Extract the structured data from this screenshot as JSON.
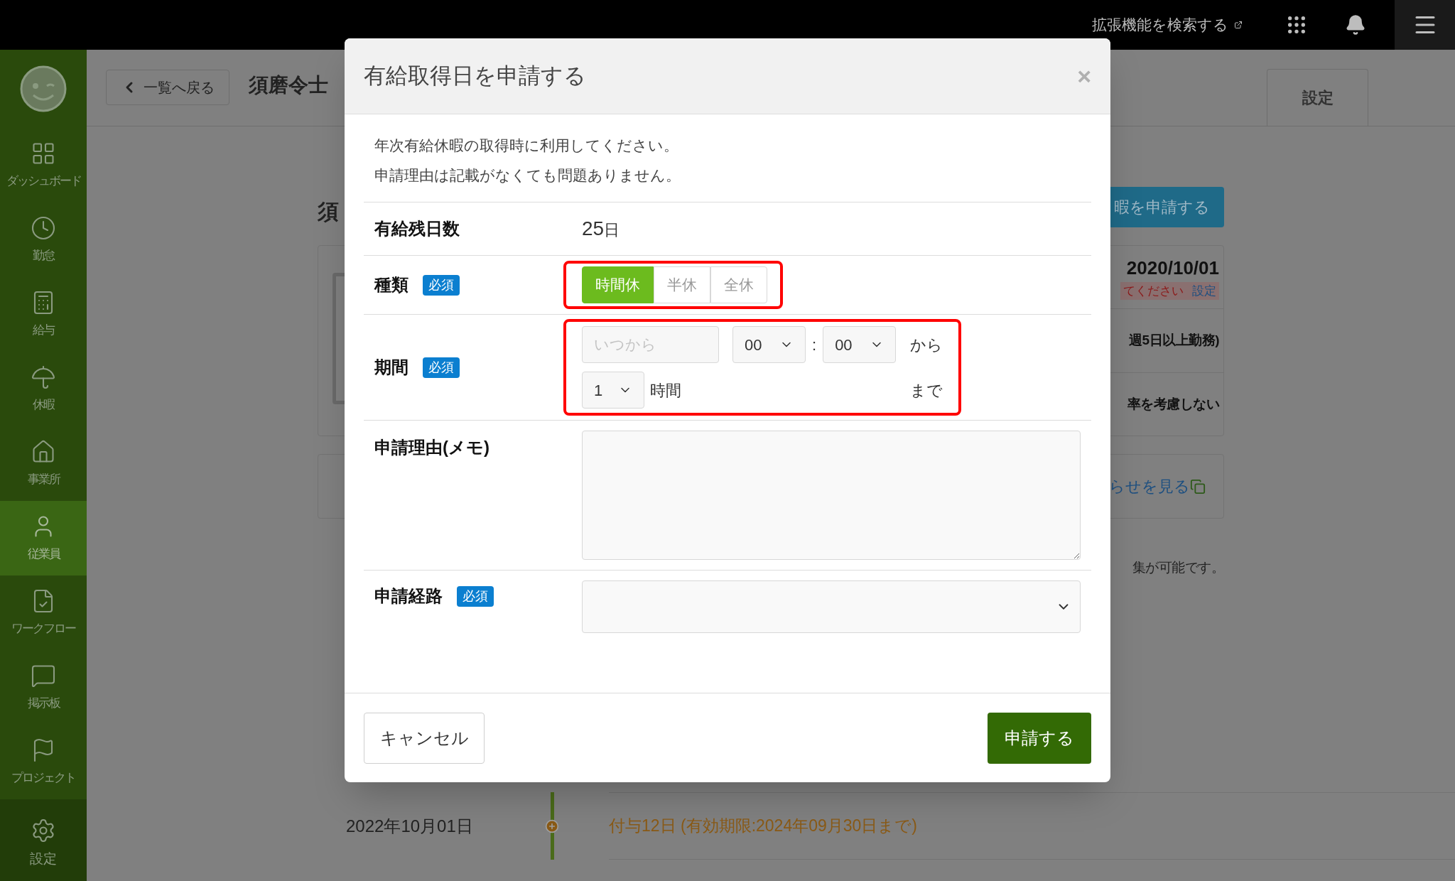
{
  "topbar": {
    "extension_link": "拡張機能を検索する"
  },
  "sidebar": {
    "items": [
      {
        "label": "ダッシュボード",
        "selected": false
      },
      {
        "label": "勤怠",
        "selected": false
      },
      {
        "label": "給与",
        "selected": false
      },
      {
        "label": "休暇",
        "selected": false
      },
      {
        "label": "事業所",
        "selected": false
      },
      {
        "label": "従業員",
        "selected": true
      },
      {
        "label": "ワークフロー",
        "selected": false
      },
      {
        "label": "掲示板",
        "selected": false
      },
      {
        "label": "プロジェクト",
        "selected": false
      }
    ],
    "settings": "設定"
  },
  "header": {
    "back_button": "一覧へ戻る",
    "employee_name": "須磨令士",
    "tab": "設定"
  },
  "page": {
    "heading": "須",
    "apply_button": "暇を申請する",
    "card_rows": [
      {
        "kind": "date",
        "text": "2020/10/01",
        "note": "てください",
        "link": "設定"
      },
      {
        "kind": "plain",
        "text": "週5日以上勤務)"
      },
      {
        "kind": "plain",
        "text": "率を考慮しない"
      }
    ],
    "notice_link": "らせを見る",
    "note": "集が可能です。",
    "timeline": [
      {
        "date": "2022年10月01日",
        "text": "付与12日 (有効期限:2024年09月30日まで)"
      }
    ]
  },
  "modal": {
    "title": "有給取得日を申請する",
    "close": "×",
    "description": [
      "年次有給休暇の取得時に利用してください。",
      "申請理由は記載がなくても問題ありません。"
    ],
    "remaining": {
      "label": "有給残日数",
      "value": "25",
      "unit": "日"
    },
    "type": {
      "label": "種類",
      "required": "必須",
      "options": [
        {
          "label": "時間休",
          "selected": true
        },
        {
          "label": "半休",
          "selected": false
        },
        {
          "label": "全休",
          "selected": false
        }
      ]
    },
    "period": {
      "label": "期間",
      "required": "必須",
      "date_placeholder": "いつから",
      "hour": "00",
      "colon": ":",
      "minute": "00",
      "from": "から",
      "duration": "1",
      "duration_unit": "時間",
      "until": "まで"
    },
    "memo": {
      "label": "申請理由(メモ)"
    },
    "route": {
      "label": "申請経路",
      "required": "必須"
    },
    "cancel": "キャンセル",
    "submit": "申請する"
  }
}
